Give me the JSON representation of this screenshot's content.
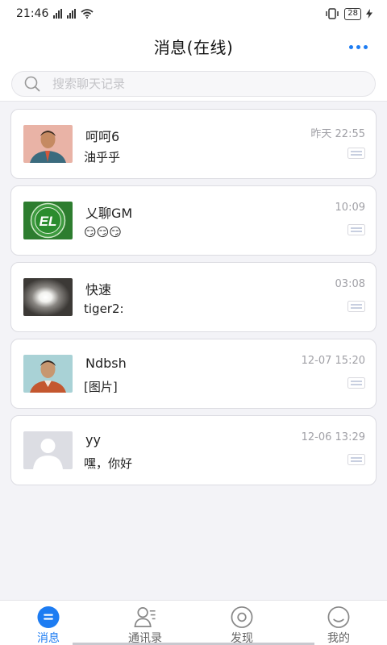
{
  "status_bar": {
    "time": "21:46",
    "battery": "28"
  },
  "header": {
    "title": "消息(在线)",
    "more_icon": "more-dots-icon"
  },
  "search": {
    "placeholder": "搜索聊天记录",
    "icon": "search-icon"
  },
  "conversations": [
    {
      "name": "呵呵6",
      "preview": "油乎乎",
      "time": "昨天 22:55",
      "avatar": "man-photo-avatar"
    },
    {
      "name": "乂聊GM",
      "preview": "😏😏😏",
      "time": "10:09",
      "avatar": "el-logo-avatar"
    },
    {
      "name": "快速",
      "preview": "tiger2:",
      "time": "03:08",
      "avatar": "light-photo-avatar"
    },
    {
      "name": "Ndbsh",
      "preview": "[图片]",
      "time": "12-07 15:20",
      "avatar": "man-photo-avatar"
    },
    {
      "name": "yy",
      "preview": "嘿，你好",
      "time": "12-06 13:29",
      "avatar": "default-avatar"
    }
  ],
  "tabs": [
    {
      "label": "消息",
      "icon": "message-icon",
      "active": true
    },
    {
      "label": "通讯录",
      "icon": "contacts-icon",
      "active": false
    },
    {
      "label": "发现",
      "icon": "discover-icon",
      "active": false
    },
    {
      "label": "我的",
      "icon": "profile-icon",
      "active": false
    }
  ],
  "colors": {
    "accent": "#1d7cf2",
    "background": "#f3f3f7",
    "card_border": "#dcdce2",
    "time_text": "#a0a0a6"
  }
}
